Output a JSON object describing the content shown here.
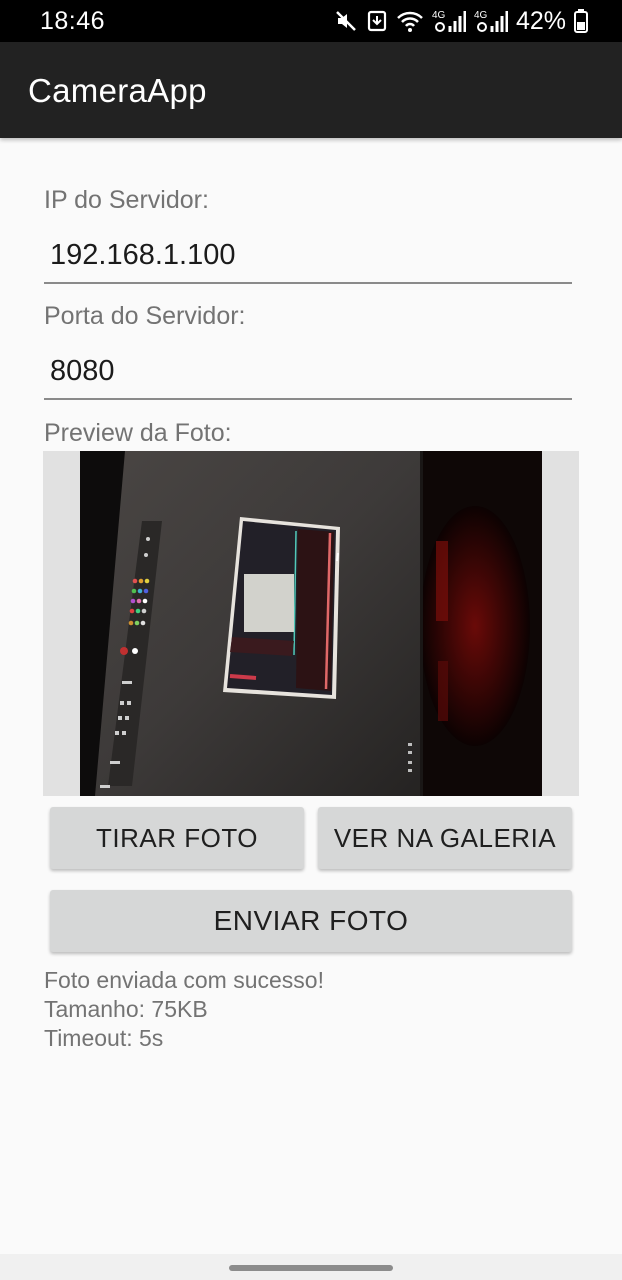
{
  "status_bar": {
    "time": "18:46",
    "network_1": "4G",
    "network_2": "4G",
    "battery": "42%",
    "icons": [
      "mute-icon",
      "download-notification-icon",
      "wifi-icon",
      "signal-icon",
      "signal-icon",
      "battery-icon"
    ]
  },
  "app_bar": {
    "title": "CameraApp"
  },
  "form": {
    "ip_label": "IP do Servidor:",
    "ip_value": "192.168.1.100",
    "port_label": "Porta do Servidor:",
    "port_value": "8080",
    "preview_label": "Preview da Foto:"
  },
  "buttons": {
    "take_photo": "TIRAR FOTO",
    "view_gallery": "VER NA GALERIA",
    "send_photo": "ENVIAR FOTO"
  },
  "status": {
    "line1": "Foto enviada com sucesso!",
    "line2": "Tamanho: 75KB",
    "line3": "Timeout: 5s"
  },
  "colors": {
    "app_bar": "#222222",
    "status_bar": "#000000",
    "background": "#fafafa",
    "button": "#d6d7d7",
    "label_text": "#737373"
  }
}
